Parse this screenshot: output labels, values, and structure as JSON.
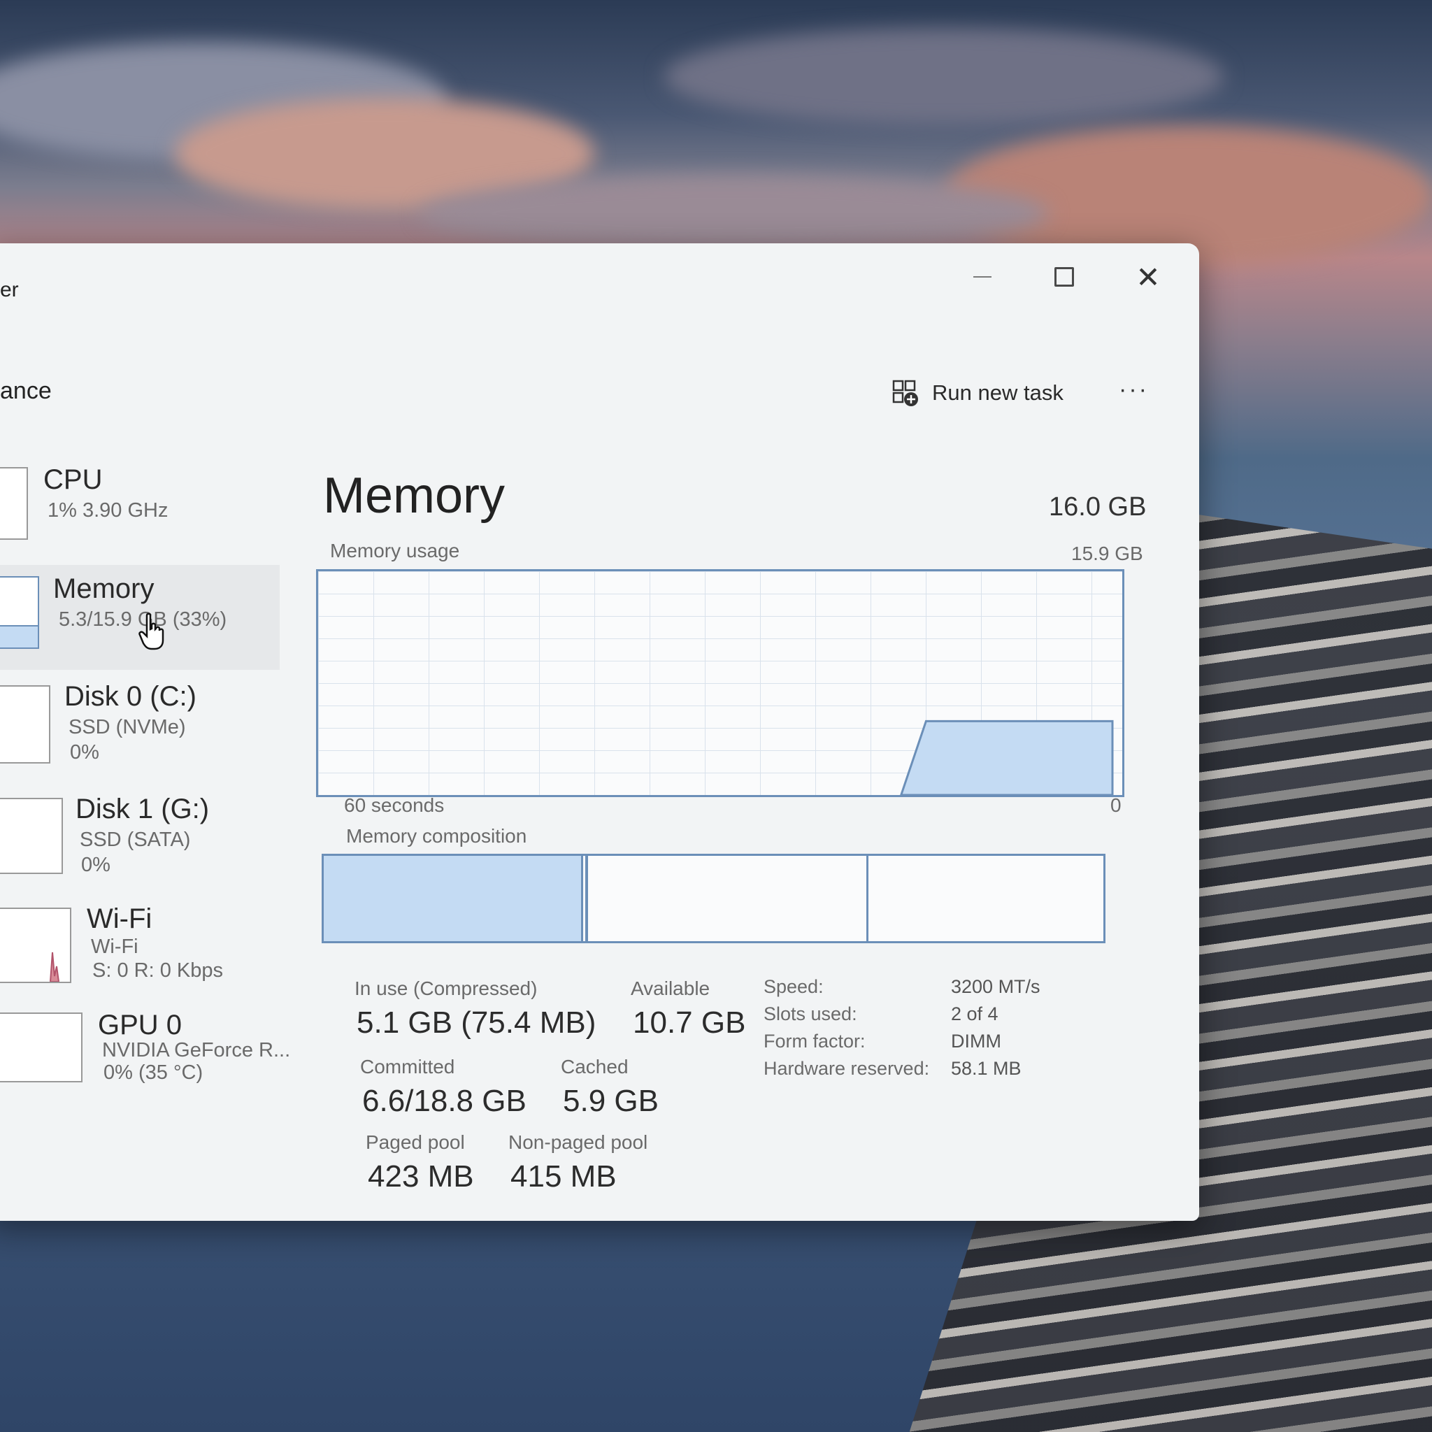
{
  "window": {
    "title_fragment": "er",
    "page_fragment": "ance",
    "toolbar": {
      "run_new_task": "Run new task",
      "more": "···"
    }
  },
  "sidebar": {
    "items": [
      {
        "title": "CPU",
        "line1": "1% 3.90 GHz",
        "line2": ""
      },
      {
        "title": "Memory",
        "line1": "5.3/15.9 GB (33%)",
        "line2": ""
      },
      {
        "title": "Disk 0 (C:)",
        "line1": "SSD (NVMe)",
        "line2": "0%"
      },
      {
        "title": "Disk 1 (G:)",
        "line1": "SSD (SATA)",
        "line2": "0%"
      },
      {
        "title": "Wi-Fi",
        "line1": "Wi-Fi",
        "line2": "S: 0 R: 0 Kbps"
      },
      {
        "title": "GPU 0",
        "line1": "NVIDIA GeForce R...",
        "line2": "0% (35 °C)"
      }
    ]
  },
  "main": {
    "title": "Memory",
    "total": "16.0 GB",
    "usage_label": "Memory usage",
    "usage_max": "15.9 GB",
    "time_left": "60 seconds",
    "time_right": "0",
    "composition_label": "Memory composition",
    "usage_fraction": 0.33,
    "stats": {
      "in_use_label": "In use (Compressed)",
      "in_use_value": "5.1 GB (75.4 MB)",
      "available_label": "Available",
      "available_value": "10.7 GB",
      "committed_label": "Committed",
      "committed_value": "6.6/18.8 GB",
      "cached_label": "Cached",
      "cached_value": "5.9 GB",
      "paged_label": "Paged pool",
      "paged_value": "423 MB",
      "nonpaged_label": "Non-paged pool",
      "nonpaged_value": "415 MB"
    },
    "specs": {
      "speed_label": "Speed:",
      "speed_value": "3200 MT/s",
      "slots_label": "Slots used:",
      "slots_value": "2 of 4",
      "form_label": "Form factor:",
      "form_value": "DIMM",
      "reserved_label": "Hardware reserved:",
      "reserved_value": "58.1 MB"
    }
  },
  "colors": {
    "accent": "#6b8fb8",
    "fill": "#c4dbf3"
  }
}
